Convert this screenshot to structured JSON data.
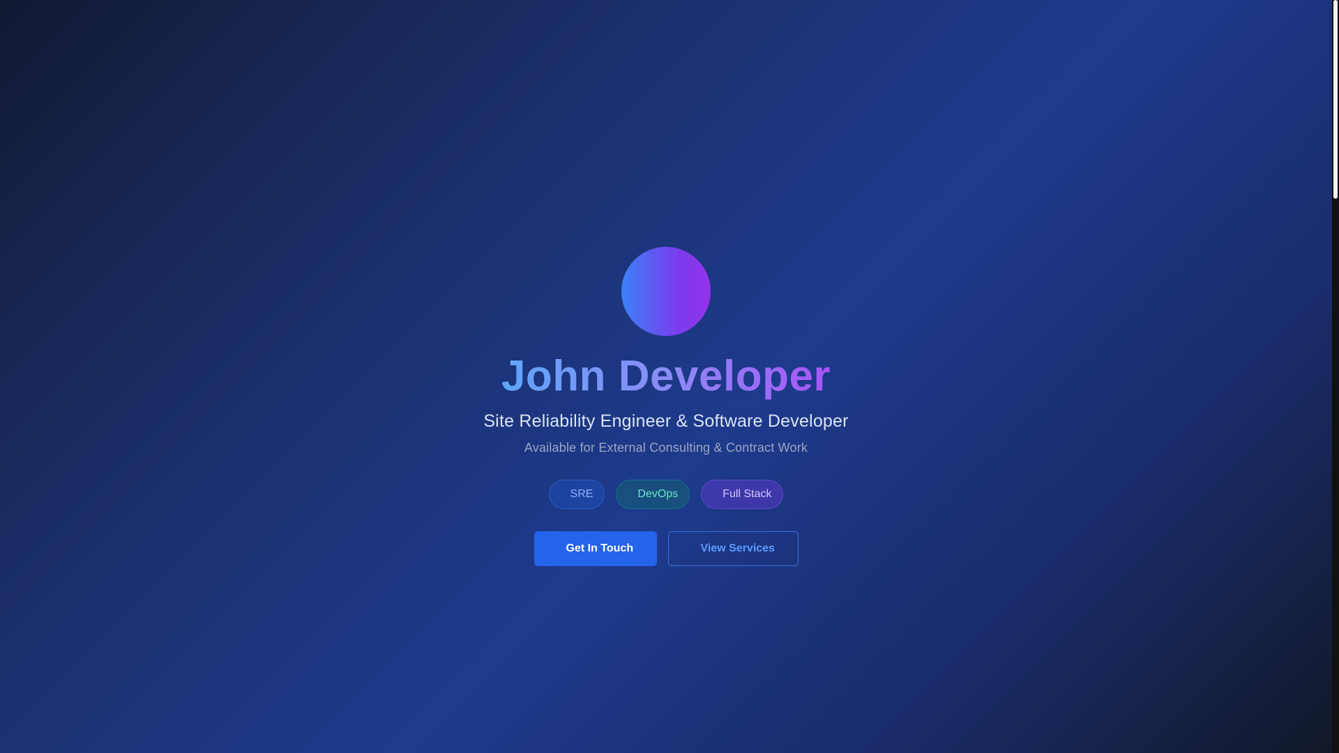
{
  "profile": {
    "name": "John Developer",
    "subtitle": "Site Reliability Engineer & Software Developer",
    "availability": "Available for External Consulting & Contract Work"
  },
  "tags": [
    {
      "label": "SRE",
      "color": "#8fb4ff"
    },
    {
      "label": "DevOps",
      "color": "#6ee7c7"
    },
    {
      "label": "Full Stack",
      "color": "#d8c8ff"
    }
  ],
  "actions": {
    "primary_label": "Get In Touch",
    "secondary_label": "View Services"
  },
  "colors": {
    "accent": "#2563eb",
    "avatar_start": "#3b82f6",
    "avatar_end": "#9333ea"
  },
  "scroll_position": 0
}
